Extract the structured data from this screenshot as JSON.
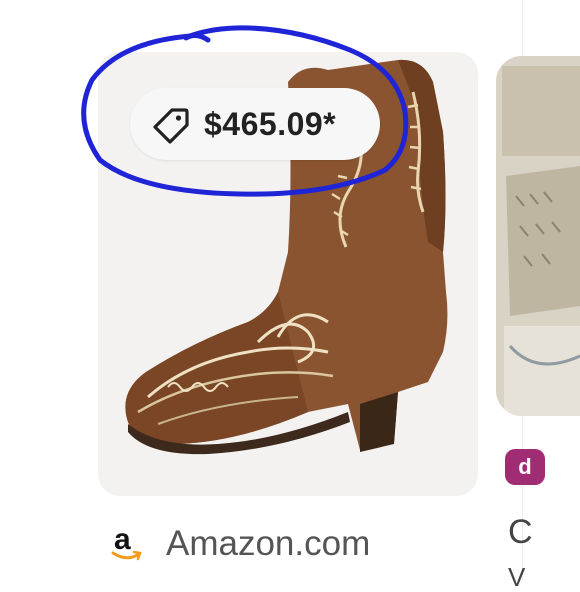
{
  "result_card": {
    "price": "$465.09*",
    "source": "Amazon.com",
    "price_icon": "tag-icon",
    "source_icon": "amazon-logo-icon"
  },
  "next_card": {
    "badge_letter": "d",
    "title_partial": "C",
    "title_partial_2": "V"
  },
  "colors": {
    "annotation": "#1f25d6",
    "badge": "#a02c73"
  }
}
